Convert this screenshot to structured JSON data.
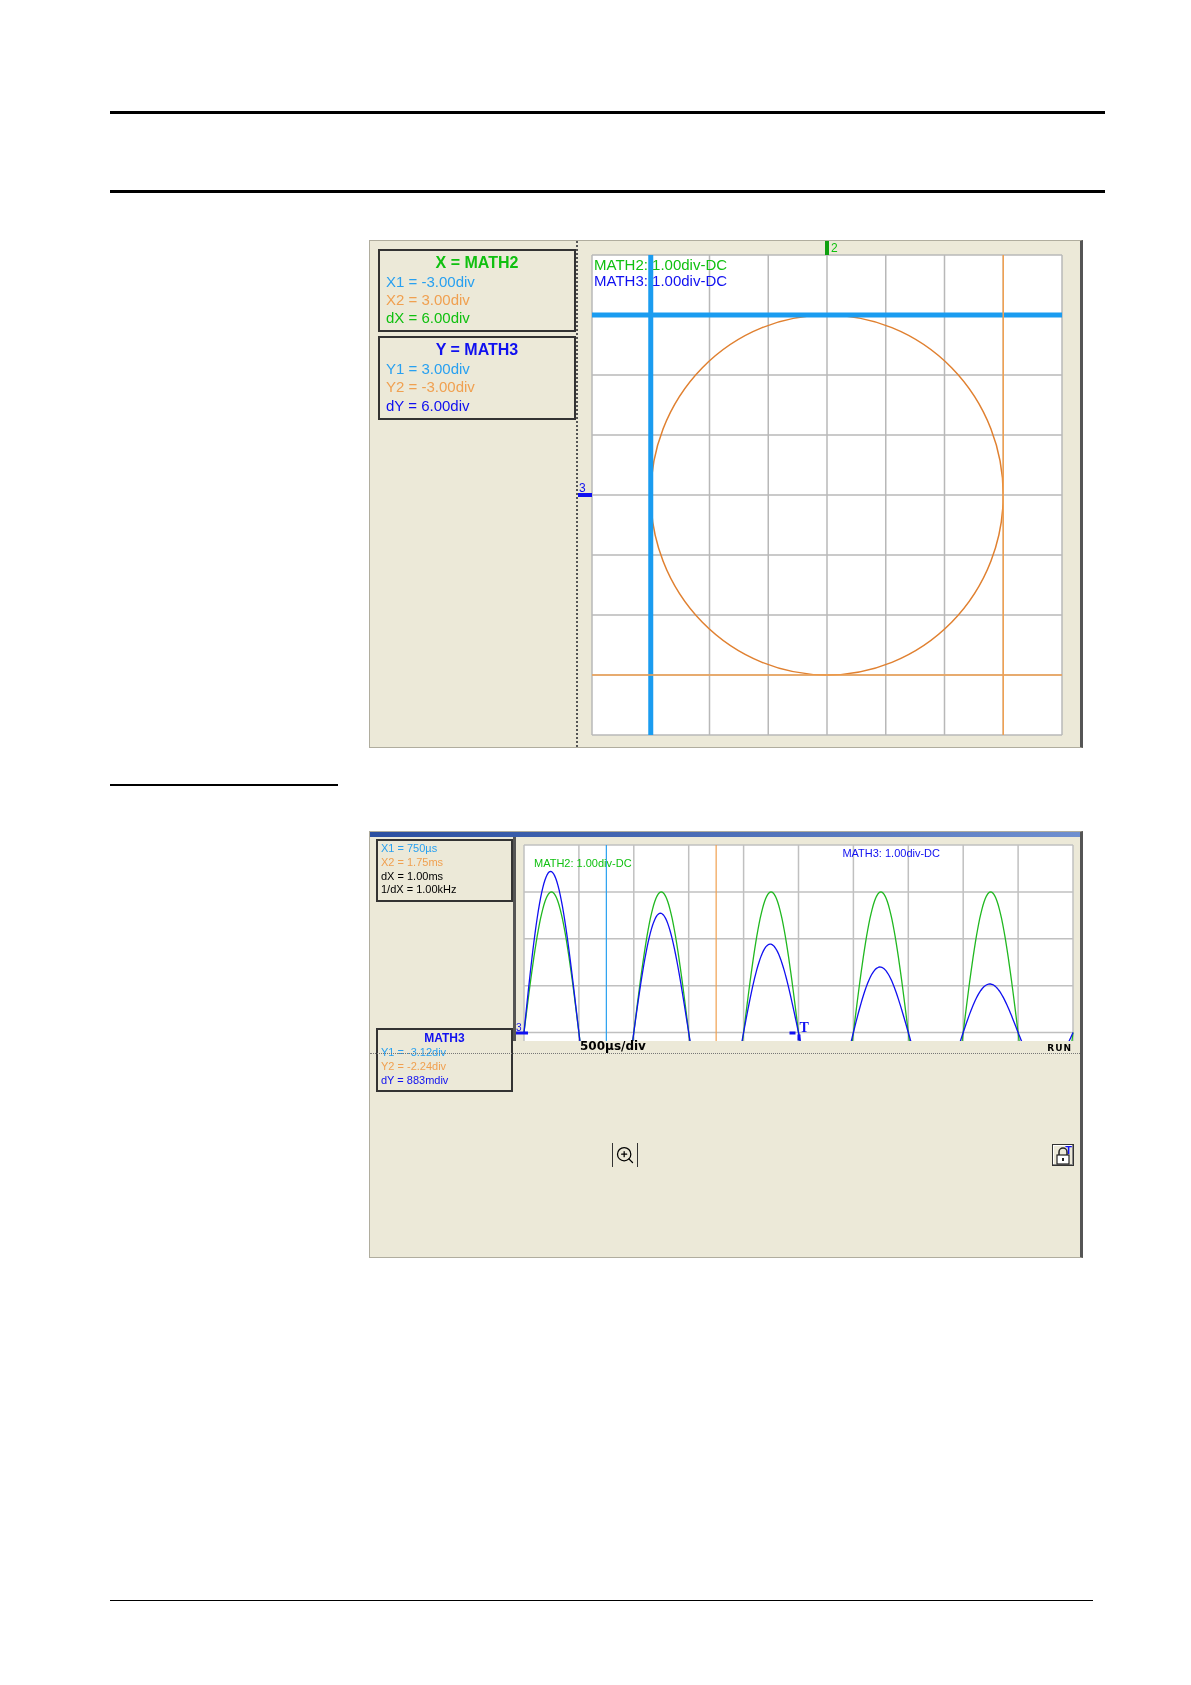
{
  "xy_view": {
    "panels": [
      {
        "title": "X = MATH2",
        "color": "#10c010",
        "lines": [
          {
            "text": "X1 = -3.00div",
            "color": "#28a0f0"
          },
          {
            "text": "X2 = 3.00div",
            "color": "#f0a050"
          },
          {
            "text": "dX = 6.00div",
            "color": "#10c010"
          }
        ]
      },
      {
        "title": "Y = MATH3",
        "color": "#1010f0",
        "lines": [
          {
            "text": "Y1 = 3.00div",
            "color": "#28a0f0"
          },
          {
            "text": "Y2 = -3.00div",
            "color": "#f0a050"
          },
          {
            "text": "dY = 6.00div",
            "color": "#1010f0"
          }
        ]
      }
    ],
    "trace_labels": [
      {
        "text": "MATH2: 1.00div-DC",
        "color": "#10c010"
      },
      {
        "text": "MATH3: 1.00div-DC",
        "color": "#1010f0"
      }
    ],
    "x_marker": "2",
    "y_marker": "3"
  },
  "time_view": {
    "panels": [
      {
        "lines": [
          {
            "text": "X1 = 750µs",
            "color": "#28a0f0"
          },
          {
            "text": "X2 = 1.75ms",
            "color": "#f0a050"
          },
          {
            "text": "dX = 1.00ms",
            "color": "#000000"
          },
          {
            "text": "1/dX = 1.00kHz",
            "color": "#000000"
          }
        ]
      },
      {
        "title": "MATH3",
        "color": "#1010f0",
        "lines": [
          {
            "text": "Y1 = -3.12div",
            "color": "#28a0f0"
          },
          {
            "text": "Y2 = -2.24div",
            "color": "#f0a050"
          },
          {
            "text": "dY = 883mdiv",
            "color": "#1010f0"
          }
        ]
      }
    ],
    "trace_labels": [
      {
        "text": "MATH2: 1.00div-DC",
        "color": "#10c010"
      },
      {
        "text": "MATH3: 1.00div-DC",
        "color": "#1010f0"
      }
    ],
    "channel_marker": "3",
    "trigger_marker": "T",
    "timebase": "500µs/div",
    "run_state": "RUN",
    "lock_label": "T"
  }
}
